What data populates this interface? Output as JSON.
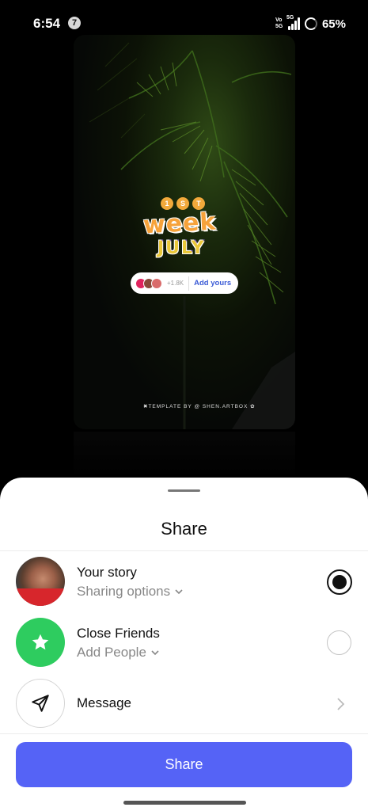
{
  "status_bar": {
    "time": "6:54",
    "notification_count": "7",
    "volte": "Vo\n5G",
    "network": "5G",
    "battery": "65%"
  },
  "story": {
    "sticker_numbers": [
      "1",
      "S",
      "T"
    ],
    "sticker_word": "week",
    "sticker_month": "JULY",
    "add_yours_count": "+1.8K",
    "add_yours_label": "Add yours",
    "template_credit": "✖TEMPLATE BY @ SHEN.ARTBOX ✿"
  },
  "sheet": {
    "title": "Share",
    "rows": [
      {
        "title": "Your story",
        "subtitle": "Sharing options",
        "selected": true
      },
      {
        "title": "Close Friends",
        "subtitle": "Add People",
        "selected": false
      },
      {
        "title": "Message"
      }
    ],
    "share_button": "Share"
  },
  "colors": {
    "accent": "#5563f6",
    "close_friends_green": "#2ecc5f",
    "add_yours_blue": "#3b5bd6"
  }
}
